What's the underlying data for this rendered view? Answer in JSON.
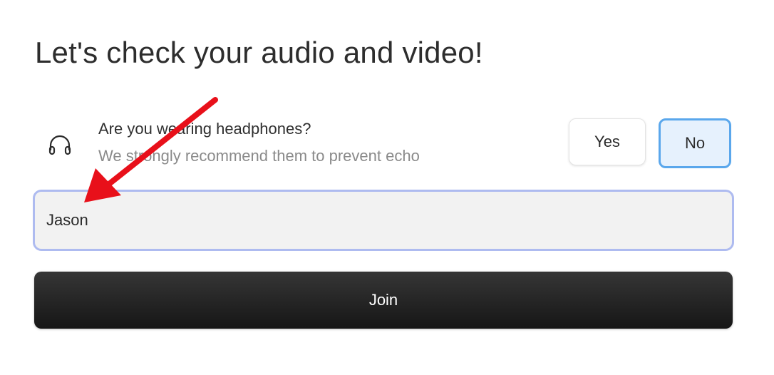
{
  "heading": "Let's check your audio and video!",
  "headphones": {
    "icon": "headphones-icon",
    "question": "Are you wearing headphones?",
    "hint": "We strongly recommend them to prevent echo",
    "yes_label": "Yes",
    "no_label": "No",
    "selected": "No"
  },
  "name_input": {
    "value": "Jason"
  },
  "join_label": "Join",
  "annotation": {
    "icon": "red-arrow-icon",
    "color": "#e8101a"
  },
  "colors": {
    "selected_border": "#5aa7ec",
    "selected_fill": "#e6f1fd",
    "input_border": "#aebbf0",
    "join_bg": "#1f1f1f"
  }
}
